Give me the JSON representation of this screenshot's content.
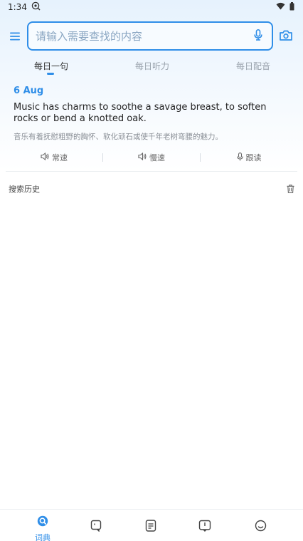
{
  "status_bar": {
    "time": "1:34",
    "notification_icon": "search-bubble-icon",
    "wifi_icon": "wifi-icon",
    "battery_icon": "battery-icon"
  },
  "header": {
    "menu_icon": "menu-icon",
    "search": {
      "placeholder": "请输入需要查找的内容",
      "value": ""
    },
    "mic_icon": "microphone-icon",
    "camera_icon": "camera-icon"
  },
  "tabs": [
    {
      "label": "每日一句",
      "active": true
    },
    {
      "label": "每日听力",
      "active": false
    },
    {
      "label": "每日配音",
      "active": false
    }
  ],
  "daily": {
    "date": "6 Aug",
    "english": "Music has charms to soothe a savage breast, to soften rocks or bend a knotted oak.",
    "chinese": "音乐有着抚慰粗野的胸怀、软化顽石或使千年老树弯腰的魅力。"
  },
  "audio_controls": [
    {
      "label": "常速",
      "icon": "speaker-icon"
    },
    {
      "label": "慢速",
      "icon": "speaker-icon"
    },
    {
      "label": "跟读",
      "icon": "microphone-icon"
    }
  ],
  "history": {
    "title": "搜索历史",
    "delete_icon": "trash-icon"
  },
  "bottom_nav": [
    {
      "label": "词典",
      "icon": "search-icon",
      "active": true
    },
    {
      "label": "",
      "icon": "translate-icon",
      "active": false
    },
    {
      "label": "",
      "icon": "notes-icon",
      "active": false
    },
    {
      "label": "",
      "icon": "book-icon",
      "active": false
    },
    {
      "label": "",
      "icon": "profile-icon",
      "active": false
    }
  ],
  "colors": {
    "accent": "#2f8ee8",
    "muted": "#9aa3ad"
  }
}
